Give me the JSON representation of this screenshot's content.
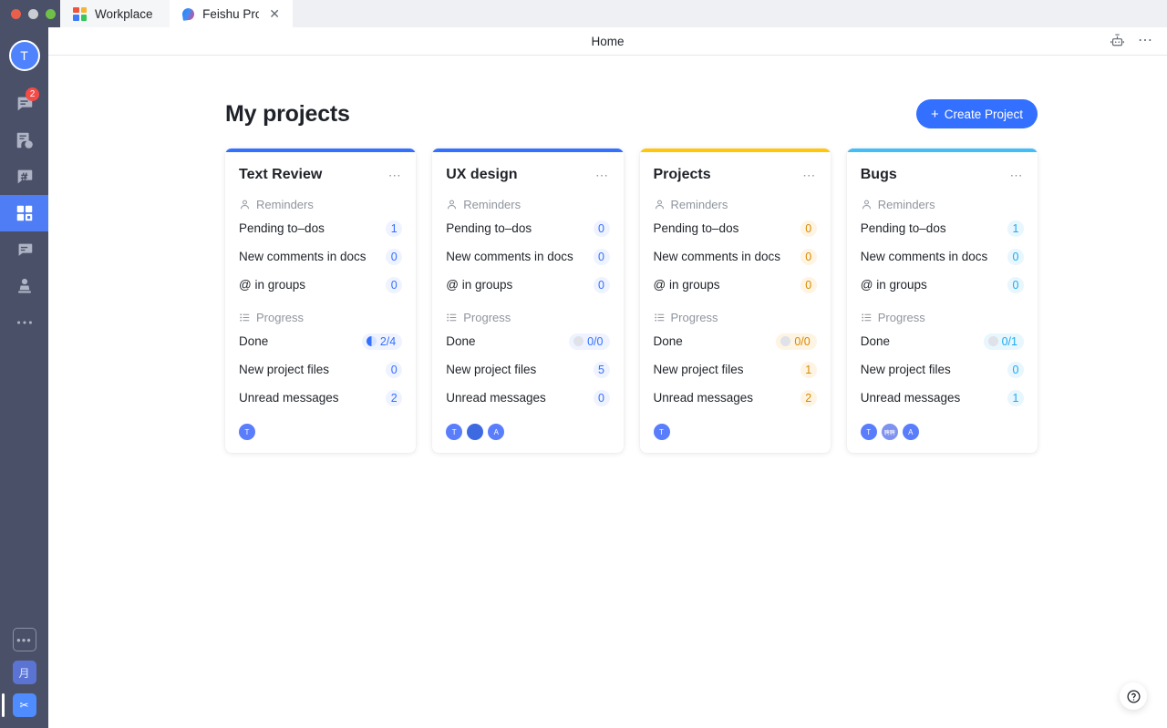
{
  "window": {
    "tabs": [
      {
        "label": "Workplace",
        "icon": "workplace-grid-icon",
        "active": false
      },
      {
        "label": "Feishu Proje",
        "icon": "feishu-icon",
        "active": true,
        "closable": true
      }
    ]
  },
  "sidebar": {
    "avatar_initial": "T",
    "items": [
      {
        "name": "messenger",
        "icon": "chat-bubble-icon",
        "badge": "2",
        "active": false
      },
      {
        "name": "docs",
        "icon": "docs-cloud-icon",
        "badge": "",
        "active": false
      },
      {
        "name": "channels",
        "icon": "hash-bubble-icon",
        "badge": "",
        "active": false
      },
      {
        "name": "workplace",
        "icon": "grid-apps-icon",
        "badge": "",
        "active": true
      },
      {
        "name": "comments",
        "icon": "chat-lines-icon",
        "badge": "",
        "active": false
      },
      {
        "name": "contacts",
        "icon": "person-stamp-icon",
        "badge": "",
        "active": false
      },
      {
        "name": "more",
        "icon": "ellipsis-icon",
        "badge": "",
        "active": false
      }
    ],
    "bottom_items": [
      {
        "name": "more-apps",
        "label": "•••",
        "style": "outline"
      },
      {
        "name": "calendar-app",
        "label": "月",
        "style": "b1"
      },
      {
        "name": "tools-app",
        "label": "✂",
        "style": "b2"
      }
    ]
  },
  "topbar": {
    "title": "Home",
    "bot_icon": "robot-icon",
    "more_icon": "ellipsis-icon"
  },
  "page": {
    "title": "My projects",
    "create_button": "Create Project",
    "create_icon": "plus-icon",
    "help_icon": "question-circle-icon"
  },
  "sections": {
    "reminders_label": "Reminders",
    "reminders_icon": "person-icon",
    "progress_label": "Progress",
    "progress_icon": "list-icon"
  },
  "colors": {
    "blue": "#3370ff",
    "orange": "#ffb400",
    "cyan": "#42bdf7",
    "value_blue_text": "#3370ff",
    "value_blue_bg": "#eef3ff",
    "value_orange_text": "#d98a00",
    "value_orange_bg": "#fdf4e3",
    "value_cyan_text": "#1eaaee",
    "value_cyan_bg": "#e8f6fe",
    "sidebar_bg": "#4a5068"
  },
  "cards": [
    {
      "title": "Text Review",
      "accent": "#3370ff",
      "value_text": "#3370ff",
      "value_bg": "#eef3ff",
      "more_icon": "ellipsis-icon",
      "reminders": [
        {
          "label": "Pending to–dos",
          "value": "1"
        },
        {
          "label": "New comments in docs",
          "value": "0"
        },
        {
          "label": "@ in groups",
          "value": "0"
        }
      ],
      "progress": [
        {
          "label": "Done",
          "value": "2/4",
          "pie": true,
          "pie_fill": 50,
          "pie_color": "#3370ff"
        },
        {
          "label": "New project files",
          "value": "0",
          "pie": false
        },
        {
          "label": "Unread messages",
          "value": "2",
          "pie": false
        }
      ],
      "members": [
        {
          "label": "T",
          "bg": "#5a7dfb",
          "type": "initial"
        }
      ]
    },
    {
      "title": "UX design",
      "accent": "#3370ff",
      "value_text": "#3370ff",
      "value_bg": "#eef3ff",
      "more_icon": "ellipsis-icon",
      "reminders": [
        {
          "label": "Pending to–dos",
          "value": "0"
        },
        {
          "label": "New comments in docs",
          "value": "0"
        },
        {
          "label": "@ in groups",
          "value": "0"
        }
      ],
      "progress": [
        {
          "label": "Done",
          "value": "0/0",
          "pie": true,
          "pie_fill": 0,
          "pie_color": "#c2c7d0"
        },
        {
          "label": "New project files",
          "value": "5",
          "pie": false
        },
        {
          "label": "Unread messages",
          "value": "0",
          "pie": false
        }
      ],
      "members": [
        {
          "label": "T",
          "bg": "#5a7dfb",
          "type": "initial"
        },
        {
          "label": "",
          "bg": "#3d6ae0",
          "type": "photo"
        },
        {
          "label": "A",
          "bg": "#5a7dfb",
          "type": "initial"
        }
      ]
    },
    {
      "title": "Projects",
      "accent": "#ffc60a",
      "value_text": "#d98a00",
      "value_bg": "#fdf4e3",
      "more_icon": "ellipsis-icon",
      "reminders": [
        {
          "label": "Pending to–dos",
          "value": "0"
        },
        {
          "label": "New comments in docs",
          "value": "0"
        },
        {
          "label": "@ in groups",
          "value": "0"
        }
      ],
      "progress": [
        {
          "label": "Done",
          "value": "0/0",
          "pie": true,
          "pie_fill": 0,
          "pie_color": "#c2c7d0"
        },
        {
          "label": "New project files",
          "value": "1",
          "pie": false
        },
        {
          "label": "Unread messages",
          "value": "2",
          "pie": false
        }
      ],
      "members": [
        {
          "label": "T",
          "bg": "#5a7dfb",
          "type": "initial"
        }
      ]
    },
    {
      "title": "Bugs",
      "accent": "#42bdf7",
      "value_text": "#1eaaee",
      "value_bg": "#e8f6fe",
      "more_icon": "ellipsis-icon",
      "reminders": [
        {
          "label": "Pending to–dos",
          "value": "1"
        },
        {
          "label": "New comments in docs",
          "value": "0"
        },
        {
          "label": "@ in groups",
          "value": "0"
        }
      ],
      "progress": [
        {
          "label": "Done",
          "value": "0/1",
          "pie": true,
          "pie_fill": 0,
          "pie_color": "#c2c7d0"
        },
        {
          "label": "New project files",
          "value": "0",
          "pie": false
        },
        {
          "label": "Unread messages",
          "value": "1",
          "pie": false
        }
      ],
      "members": [
        {
          "label": "T",
          "bg": "#5a7dfb",
          "type": "initial"
        },
        {
          "label": "聘聘",
          "bg": "#7e93f0",
          "type": "initial"
        },
        {
          "label": "A",
          "bg": "#5a7dfb",
          "type": "initial"
        }
      ]
    }
  ]
}
